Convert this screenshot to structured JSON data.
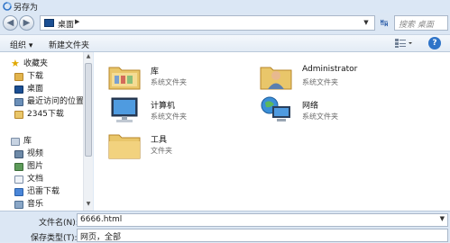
{
  "window": {
    "title": "另存为"
  },
  "address": {
    "current": "桌面",
    "separator": "▶",
    "dropdown": "▼",
    "search_placeholder": "搜索 桌面"
  },
  "nav_buttons": {
    "back": "◀",
    "forward": "▶",
    "refresh": "↹"
  },
  "toolbar": {
    "organize_label": "组织 ▾",
    "new_folder_label": "新建文件夹",
    "help_label": "?"
  },
  "sidebar": {
    "items": [
      {
        "label": "收藏夹",
        "icon": "star-icon"
      },
      {
        "label": "下载",
        "icon": "download-folder-icon"
      },
      {
        "label": "桌面",
        "icon": "desktop-icon"
      },
      {
        "label": "最近访问的位置",
        "icon": "recent-places-icon"
      },
      {
        "label": "2345下载",
        "icon": "folder-icon"
      },
      {
        "label": "库",
        "icon": "library-icon"
      },
      {
        "label": "视频",
        "icon": "video-icon"
      },
      {
        "label": "图片",
        "icon": "picture-icon"
      },
      {
        "label": "文档",
        "icon": "document-icon"
      },
      {
        "label": "迅雷下载",
        "icon": "download-folder-icon"
      },
      {
        "label": "音乐",
        "icon": "music-icon"
      }
    ]
  },
  "items": [
    {
      "name": "库",
      "type": "系统文件夹",
      "icon": "library-folder-icon"
    },
    {
      "name": "Administrator",
      "type": "系统文件夹",
      "icon": "user-folder-icon"
    },
    {
      "name": "计算机",
      "type": "系统文件夹",
      "icon": "computer-icon"
    },
    {
      "name": "网络",
      "type": "系统文件夹",
      "icon": "network-icon"
    },
    {
      "name": "工具",
      "type": "文件夹",
      "icon": "folder-icon"
    }
  ],
  "footer": {
    "filename_label": "文件名(N):",
    "filename_value": "6666.html",
    "filetype_label": "保存类型(T):",
    "filetype_value": "网页，全部"
  },
  "colors": {
    "folder": "#e9c66a",
    "accent": "#2f74c8",
    "chrome": "#dce7f4"
  }
}
